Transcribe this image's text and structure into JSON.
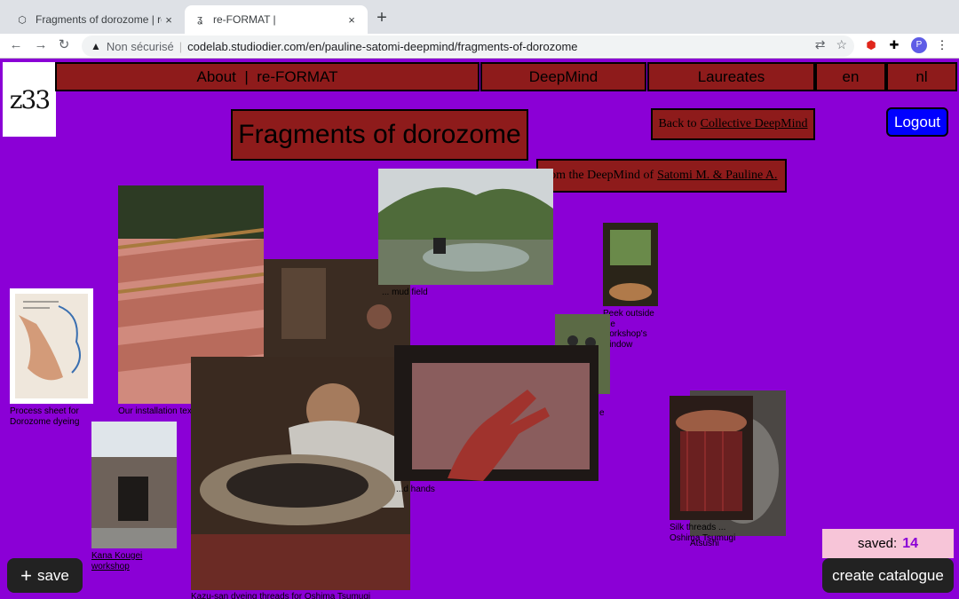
{
  "browser": {
    "tabs": [
      {
        "title": "Fragments of dorozome | re-FO",
        "close": "×"
      },
      {
        "title": "re-FORMAT |",
        "close": "×"
      }
    ],
    "new_tab": "+",
    "url_warning": "Non sécurisé",
    "url": "codelab.studiodier.com/en/pauline-satomi-deepmind/fragments-of-dorozome",
    "profile_initial": "P"
  },
  "site": {
    "logo": "z33",
    "nav": {
      "about_reformat": "About  |  re-FORMAT",
      "deepmind": "DeepMind",
      "laureates": "Laureates",
      "lang_en": "en",
      "lang_nl": "nl"
    },
    "title": "Fragments of dorozome",
    "back_prefix": "Back to",
    "back_link": "Collective DeepMind",
    "from_prefix": "rom the DeepMind of",
    "from_link": "Satomi M. & Pauline A.",
    "logout": "Logout"
  },
  "captions": {
    "process_sheet": "Process sheet for Dorozome dyeing",
    "installation": "Our installation textile drying in the...",
    "mud_field": "... mud field",
    "peek": "Peek outside the workshop's window",
    "kana": "Kana Kougei workshop",
    "hands": "...d hands",
    "silk": "Silk threads ... Oshima Tsumugi",
    "atsushi": "Atsushi",
    "kazu": "Kazu-san dyeing threads for Oshima Tsumugi",
    "small_e": "e"
  },
  "footer": {
    "save": "save",
    "save_icon": "+",
    "saved_label": "saved:",
    "saved_count": "14",
    "catalogue": "create catalogue"
  },
  "colors": {
    "background": "#8b00d6",
    "panel": "#8e1b1b",
    "logout": "#0000ff",
    "saved_box": "#f7c5d8"
  }
}
